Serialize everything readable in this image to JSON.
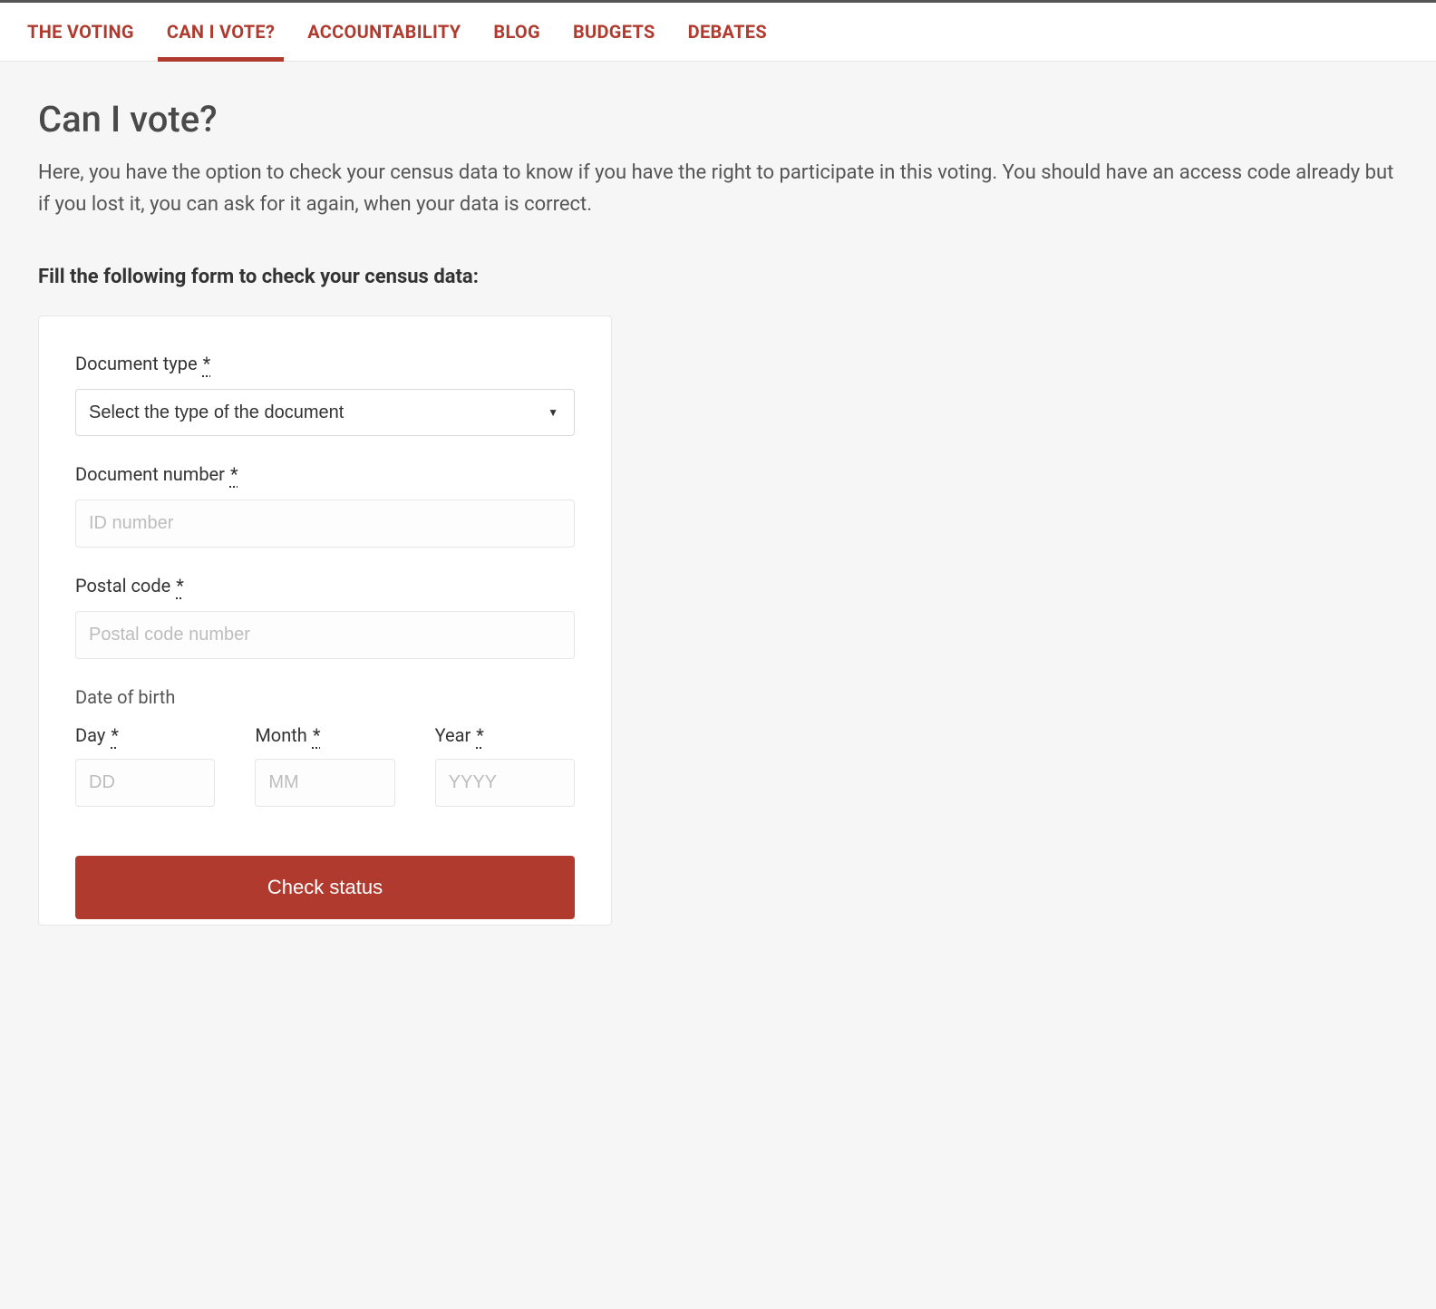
{
  "nav": {
    "items": [
      {
        "label": "THE VOTING",
        "active": false
      },
      {
        "label": "CAN I VOTE?",
        "active": true
      },
      {
        "label": "ACCOUNTABILITY",
        "active": false
      },
      {
        "label": "BLOG",
        "active": false
      },
      {
        "label": "BUDGETS",
        "active": false
      },
      {
        "label": "DEBATES",
        "active": false
      }
    ]
  },
  "page": {
    "title": "Can I vote?",
    "intro": "Here, you have the option to check your census data to know if you have the right to participate in this voting. You should have an access code already but if you lost it, you can ask for it again, when your data is correct.",
    "form_prompt": "Fill the following form to check your census data:"
  },
  "form": {
    "required_mark": "*",
    "document_type": {
      "label": "Document type",
      "selected": "Select the type of the document"
    },
    "document_number": {
      "label": "Document number",
      "placeholder": "ID number"
    },
    "postal_code": {
      "label": "Postal code",
      "placeholder": "Postal code number"
    },
    "dob": {
      "title": "Date of birth",
      "day_label": "Day",
      "day_placeholder": "DD",
      "month_label": "Month",
      "month_placeholder": "MM",
      "year_label": "Year",
      "year_placeholder": "YYYY"
    },
    "submit_label": "Check status"
  }
}
